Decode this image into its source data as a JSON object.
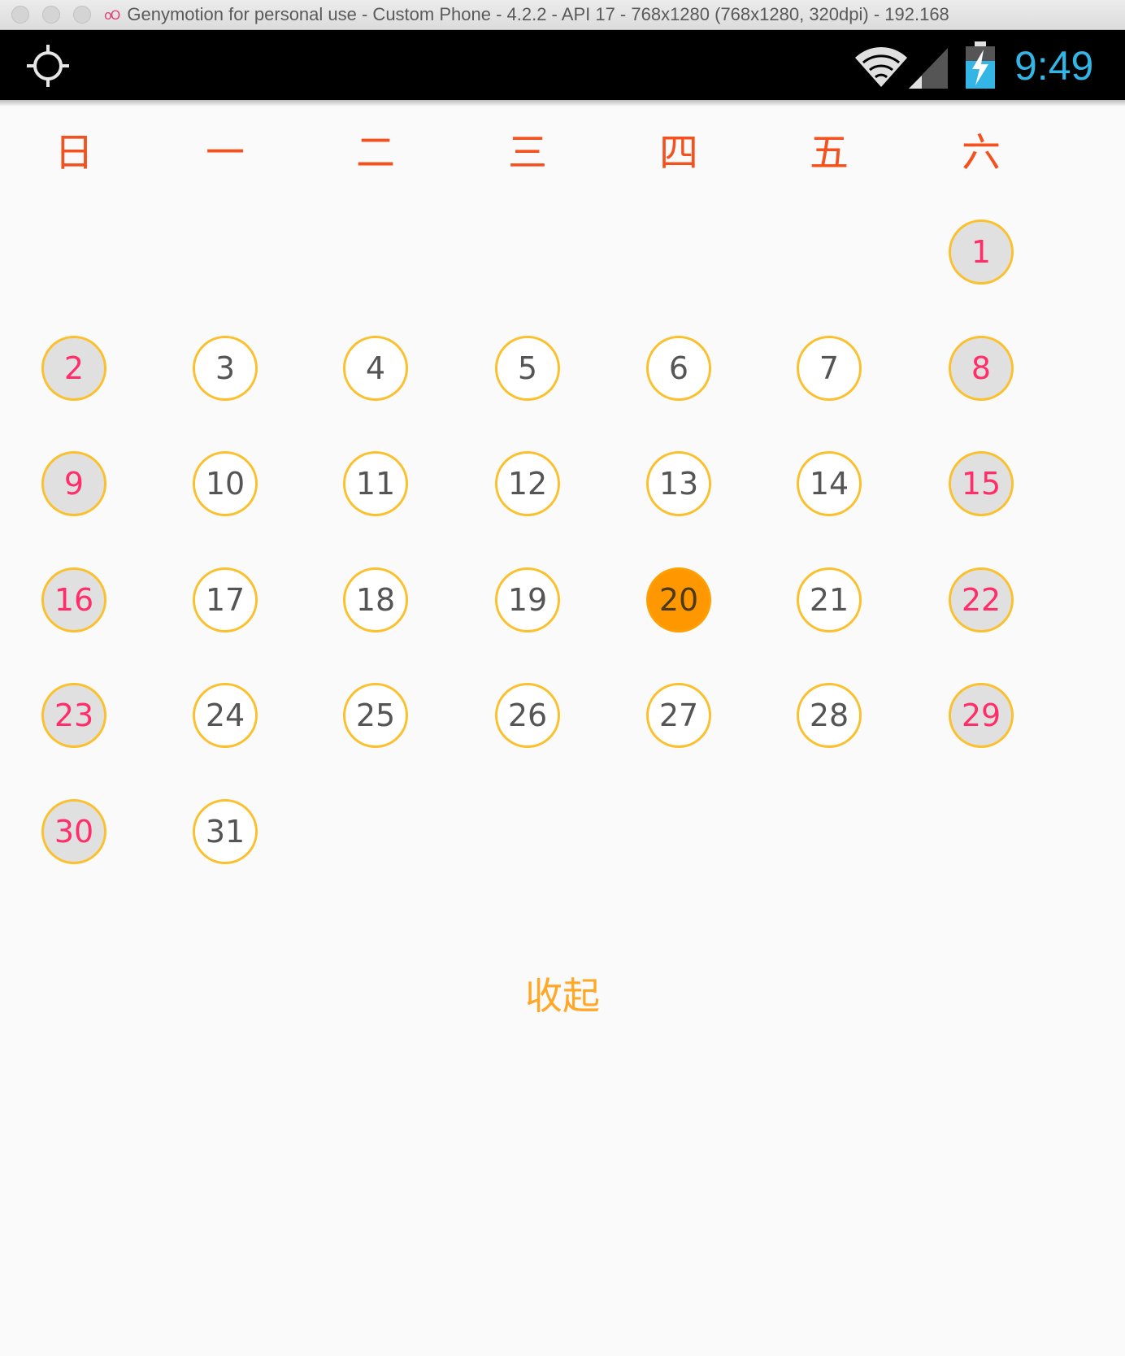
{
  "window": {
    "title": "Genymotion for personal use - Custom Phone - 4.2.2 - API 17 - 768x1280 (768x1280, 320dpi) - 192.168"
  },
  "status_bar": {
    "time": "9:49",
    "time_color": "#33b5e5",
    "icons": [
      "gps-icon",
      "wifi-icon",
      "signal-icon",
      "battery-charging-icon"
    ]
  },
  "calendar": {
    "weekdays": [
      "日",
      "一",
      "二",
      "三",
      "四",
      "五",
      "六"
    ],
    "first_weekday_column": 6,
    "days_in_month": 31,
    "selected_day": 20,
    "weekend_columns": [
      0,
      6
    ],
    "days": [
      "1",
      "2",
      "3",
      "4",
      "5",
      "6",
      "7",
      "8",
      "9",
      "10",
      "11",
      "12",
      "13",
      "14",
      "15",
      "16",
      "17",
      "18",
      "19",
      "20",
      "21",
      "22",
      "23",
      "24",
      "25",
      "26",
      "27",
      "28",
      "29",
      "30",
      "31"
    ],
    "colors": {
      "weekday_header": "#f4511e",
      "ring": "#fbc02d",
      "weekend_fill": "#e0e0e0",
      "weekend_text": "#ff2d6a",
      "selected_fill": "#ff9800",
      "normal_text": "#555555"
    }
  },
  "collapse_label": "收起"
}
